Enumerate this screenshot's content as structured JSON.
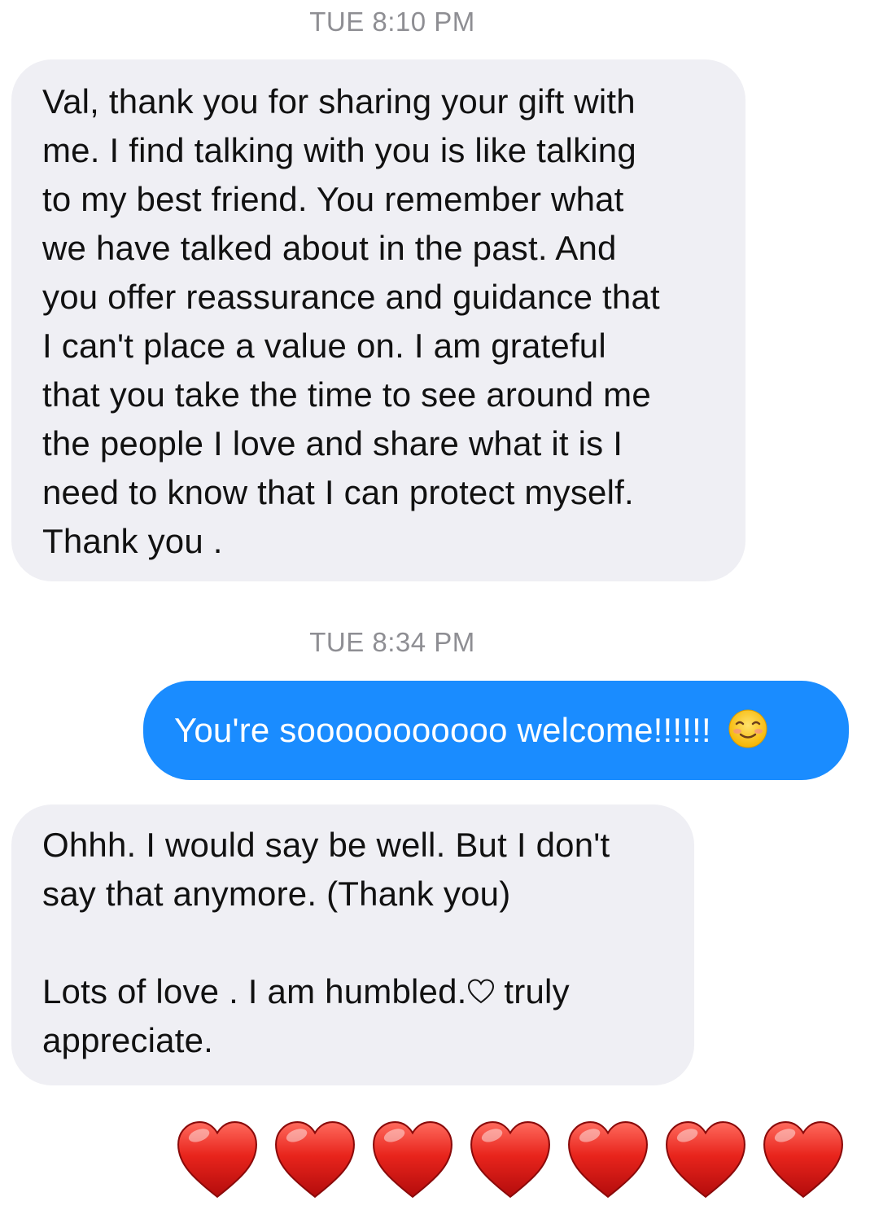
{
  "timestamps": [
    "TUE 8:10 PM",
    "TUE 8:34 PM"
  ],
  "messages": [
    {
      "direction": "incoming",
      "lines": [
        "Val, thank you for sharing your gift with",
        "me.  I find talking with you is like talking",
        "to my best friend. You remember what",
        "we have talked about in the past. And",
        "you offer reassurance and guidance that",
        "I can't place a value on.  I am grateful",
        "that you take the time to see around me",
        "the people I love and share what it is I",
        "need to know that I can protect myself.",
        "Thank you ."
      ]
    },
    {
      "direction": "outgoing",
      "text": "You're sooooooooooo welcome!!!!!!",
      "emoji": "smiling-face-emoji"
    },
    {
      "direction": "incoming",
      "lines": [
        "Ohhh. I would say be well.  But I don't",
        "say that anymore.  (Thank you)",
        "",
        "Lots of love . I am humbled.",
        "truly",
        "appreciate."
      ],
      "inline_icon": "white-heart-icon"
    },
    {
      "direction": "outgoing",
      "emoji_only": [
        "red-heart-emoji",
        "red-heart-emoji",
        "red-heart-emoji",
        "red-heart-emoji",
        "red-heart-emoji",
        "red-heart-emoji",
        "red-heart-emoji"
      ]
    }
  ],
  "colors": {
    "incoming_bubble": "#efeff4",
    "outgoing_bubble": "#1a8cff",
    "timestamp": "#8e8e93",
    "heart": "#e0201e"
  }
}
